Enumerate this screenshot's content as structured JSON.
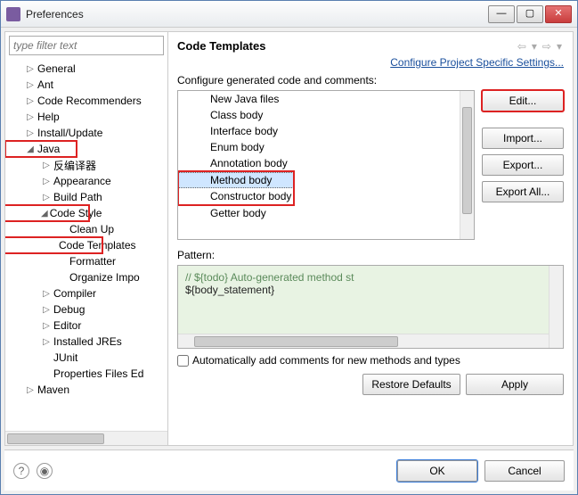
{
  "window": {
    "title": "Preferences"
  },
  "filter": {
    "placeholder": "type filter text"
  },
  "tree": {
    "general": "General",
    "ant": "Ant",
    "code_recommenders": "Code Recommenders",
    "help": "Help",
    "install_update": "Install/Update",
    "java": "Java",
    "java_children": {
      "decomp": "反编译器",
      "appearance": "Appearance",
      "build_path": "Build Path",
      "code_style": "Code Style",
      "code_style_children": {
        "clean_up": "Clean Up",
        "code_templates": "Code Templates",
        "formatter": "Formatter",
        "organize_impo": "Organize Impo"
      },
      "compiler": "Compiler",
      "debug": "Debug",
      "editor": "Editor",
      "installed_jres": "Installed JREs",
      "junit": "JUnit",
      "properties_files_ed": "Properties Files Ed"
    },
    "maven": "Maven"
  },
  "right": {
    "heading": "Code Templates",
    "link": "Configure Project Specific Settings...",
    "subheading": "Configure generated code and comments:",
    "list": {
      "new_java_files": "New Java files",
      "class_body": "Class body",
      "interface_body": "Interface body",
      "enum_body": "Enum body",
      "annotation_body": "Annotation body",
      "method_body": "Method body",
      "constructor_body": "Constructor body",
      "getter_body": "Getter body"
    },
    "buttons": {
      "edit": "Edit...",
      "import": "Import...",
      "export": "Export...",
      "export_all": "Export All..."
    },
    "pattern_label": "Pattern:",
    "pattern_line1": "// ${todo} Auto-generated method st",
    "pattern_line2": "${body_statement}",
    "checkbox": "Automatically add comments for new methods and types",
    "restore": "Restore Defaults",
    "apply": "Apply"
  },
  "footer": {
    "ok": "OK",
    "cancel": "Cancel"
  }
}
